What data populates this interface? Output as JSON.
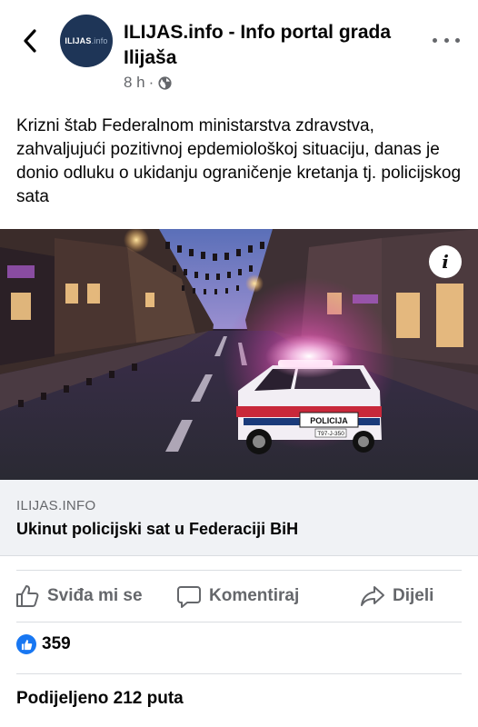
{
  "header": {
    "avatar_text_main": "ILIJAS",
    "avatar_text_dim": ".info",
    "page_name": "ILIJAS.info - Info portal grada Ilijaša",
    "time": "8 h",
    "separator": "·",
    "icons": {
      "back": "chevron-left-icon",
      "privacy": "globe-icon",
      "more": "more-dots-icon"
    }
  },
  "post": {
    "text": "Krizni štab Federalnom ministarstva zdravstva, zahvaljujući pozitivnoj epdemiološkoj situaciju, danas je donio odluku o ukidanju ograničenje kretanja tj. policijskog sata"
  },
  "photo": {
    "info_label": "i",
    "car_label": "POLICIJA",
    "plate": "T97-J-350"
  },
  "link": {
    "domain": "ILIJAS.INFO",
    "title": "Ukinut policijski sat u Federaciji BiH"
  },
  "actions": {
    "like": "Sviđa mi se",
    "comment": "Komentiraj",
    "share": "Dijeli"
  },
  "stats": {
    "reaction_count": "359",
    "shares": "Podijeljeno 212 puta"
  },
  "colors": {
    "brand_blue": "#1877f2",
    "secondary_text": "#65676b",
    "link_box_bg": "#f0f2f5",
    "avatar_bg": "#1e3557"
  }
}
